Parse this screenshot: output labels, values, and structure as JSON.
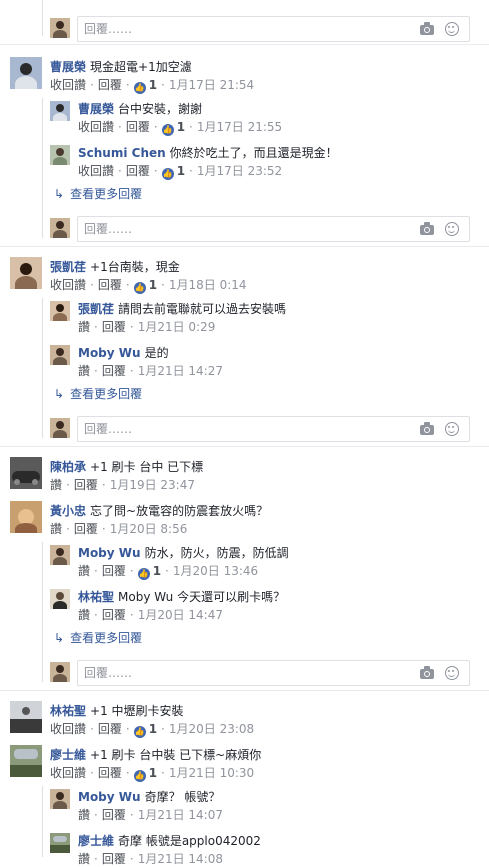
{
  "ui": {
    "like_label": "讚",
    "reply_label": "回覆",
    "unlike_label": "收回讚",
    "reply_placeholder": "回覆……",
    "view_more_label": "查看更多回覆",
    "like_icon": "thumbs-up-icon",
    "camera_icon": "camera-icon",
    "emoji_icon": "smiley-icon"
  },
  "threads": [
    {
      "name": "曹展榮",
      "text": "現金超電+1加空濾",
      "action": "收回讚",
      "likes": "1",
      "time": "1月17日 21:54",
      "replies": [
        {
          "name": "曹展榮",
          "text": "台中安裝，謝謝",
          "action": "收回讚",
          "likes": "1",
          "time": "1月17日 21:55"
        },
        {
          "name": "Schumi Chen",
          "text": "你終於吃土了，而且還是現金！",
          "action": "收回讚",
          "likes": "1",
          "time": "1月17日 23:52"
        }
      ]
    },
    {
      "name": "張凱荏",
      "text": "+1台南裝，現金",
      "action": "收回讚",
      "likes": "1",
      "time": "1月18日 0:14",
      "replies": [
        {
          "name": "張凱荏",
          "text": "請問去前電聯就可以過去安裝嗎",
          "action": "讚",
          "likes": "",
          "time": "1月21日 0:29"
        },
        {
          "name": "Moby Wu",
          "text": "是的",
          "action": "讚",
          "likes": "",
          "time": "1月21日 14:27"
        }
      ]
    },
    {
      "name": "陳柏承",
      "text": "+1 刷卡 台中 已下標",
      "action": "讚",
      "likes": "",
      "time": "1月19日 23:47",
      "replies": []
    },
    {
      "name": "黃小忠",
      "text": "忘了問~放電容的防震套放火嗎？",
      "action": "讚",
      "likes": "",
      "time": "1月20日 8:56",
      "replies": [
        {
          "name": "Moby Wu",
          "text": "防水，防火，防震，防低調",
          "action": "讚",
          "likes": "1",
          "time": "1月20日 13:46"
        },
        {
          "name": "林祐聖",
          "text": "Moby Wu 今天還可以刷卡嗎？",
          "action": "讚",
          "likes": "",
          "time": "1月20日 14:47"
        }
      ]
    },
    {
      "name": "林祐聖",
      "text": "+1 中壢刷卡安裝",
      "action": "收回讚",
      "likes": "1",
      "time": "1月20日 23:08",
      "replies": []
    },
    {
      "name": "廖士維",
      "text": "+1 刷卡 台中裝 已下標~麻煩你",
      "action": "收回讚",
      "likes": "1",
      "time": "1月21日 10:30",
      "replies": [
        {
          "name": "Moby Wu",
          "text": "奇摩？ 帳號？",
          "action": "讚",
          "likes": "",
          "time": "1月21日 14:07"
        },
        {
          "name": "廖士維",
          "text": "奇摩 帳號是applo042002",
          "action": "讚",
          "likes": "",
          "time": "1月21日 14:08"
        }
      ]
    }
  ]
}
